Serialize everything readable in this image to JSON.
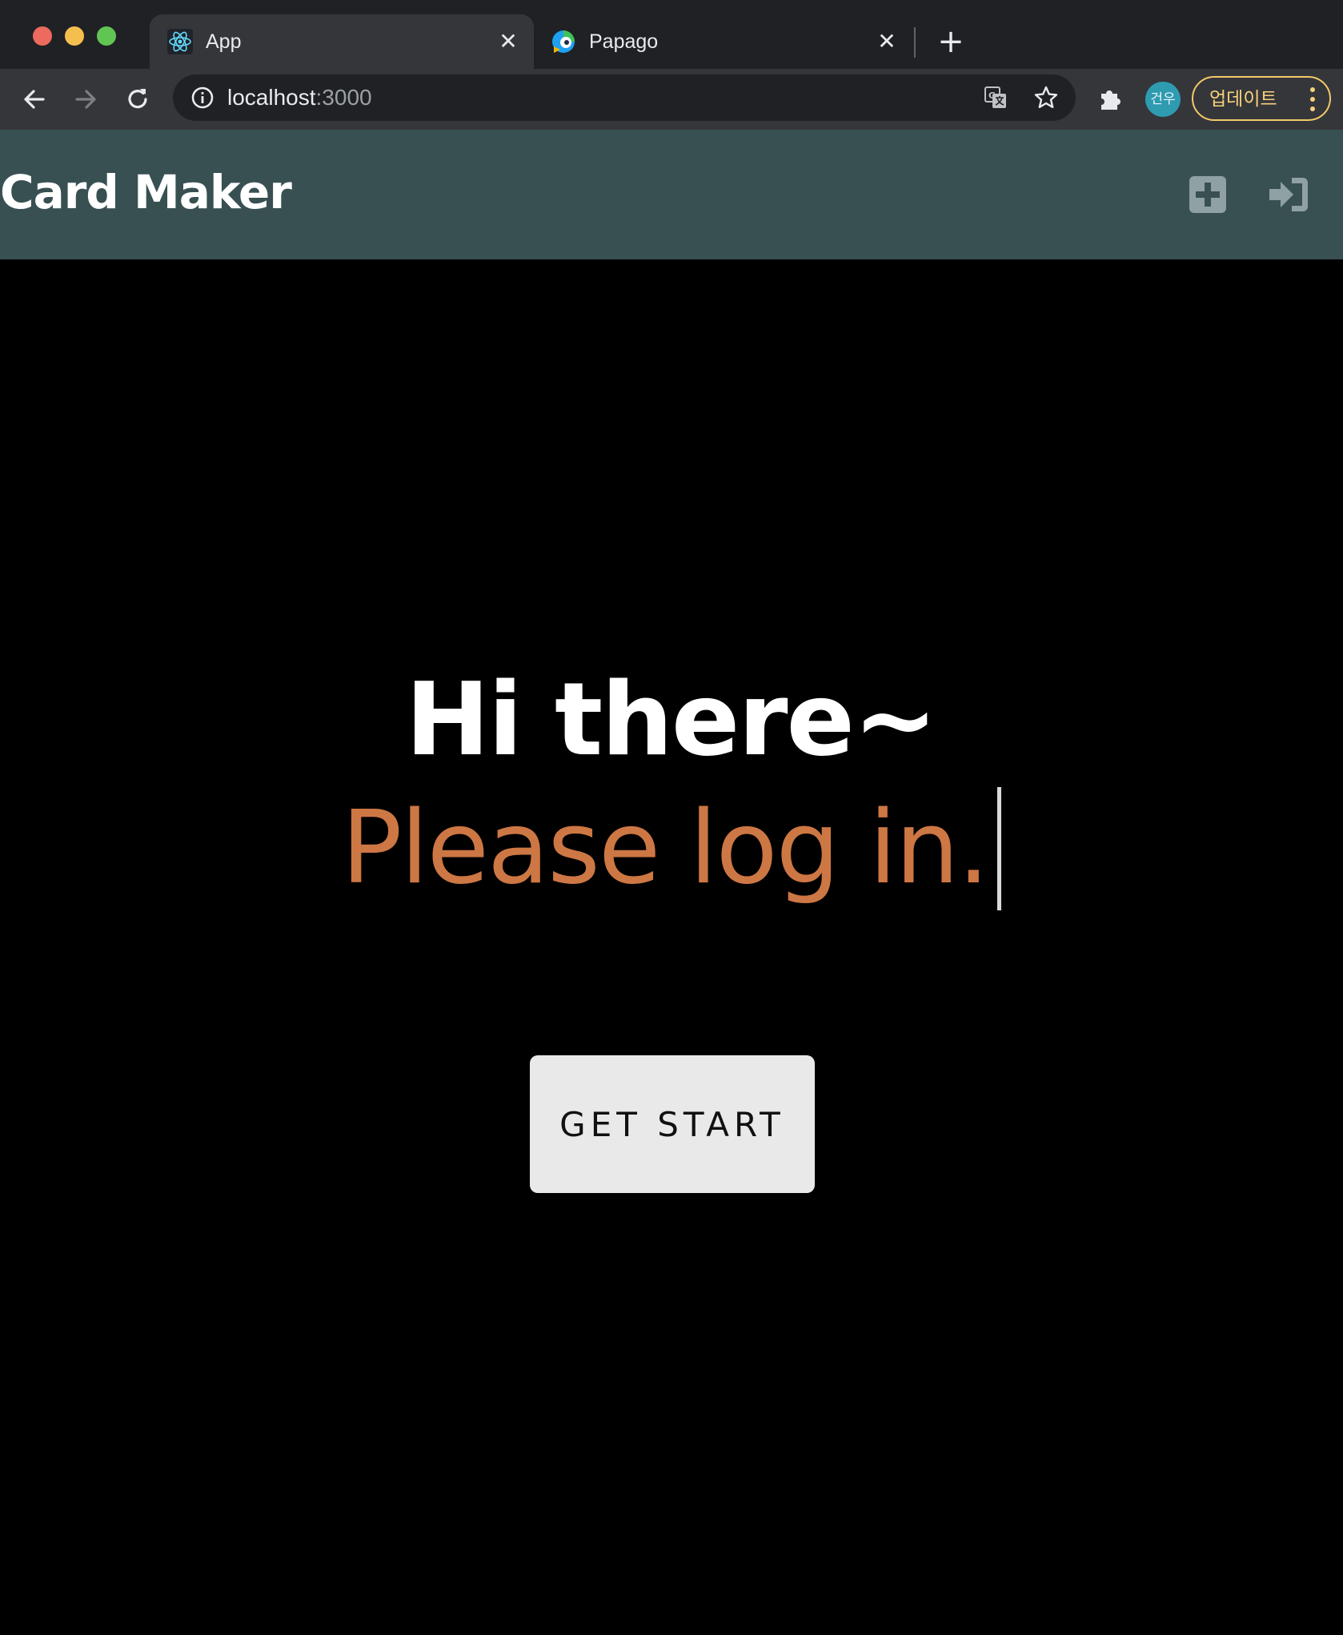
{
  "browser": {
    "tabs": [
      {
        "title": "App",
        "icon": "react-logo-icon",
        "active": true
      },
      {
        "title": "Papago",
        "icon": "papago-logo-icon",
        "active": false
      }
    ],
    "address": {
      "host": "localhost",
      "port": ":3000"
    },
    "profile_initials": "건우",
    "update_label": "업데이트"
  },
  "app": {
    "title": "Card Maker",
    "header_icons": [
      "plus-square-icon",
      "sign-in-icon"
    ],
    "header_icon_color": "#8fa1a3"
  },
  "hero": {
    "greeting": "Hi there~",
    "prompt": "Please log in.",
    "prompt_color": "#cd7744",
    "button_label": "GET START"
  },
  "colors": {
    "header_bg": "#385052",
    "page_bg": "#000000",
    "button_bg": "#e9e9e9",
    "update_accent": "#f3c969"
  }
}
